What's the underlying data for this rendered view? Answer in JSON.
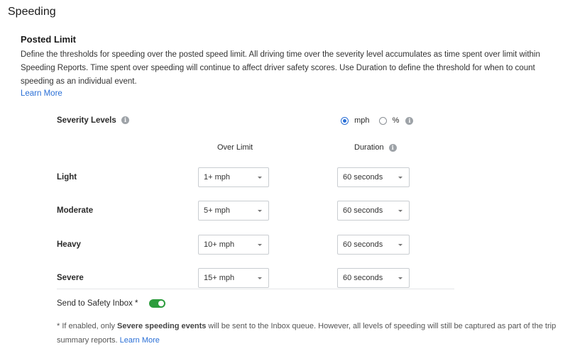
{
  "section": {
    "title": "Speeding",
    "subtitle": "Posted Limit",
    "description": "Define the thresholds for speeding over the posted speed limit. All driving time over the severity level accumulates as time spent over limit within Speeding Reports. Time spent over speeding will continue to affect driver safety scores. Use Duration to define the threshold for when to count speeding as an individual event.",
    "learn_more": "Learn More"
  },
  "severity": {
    "label": "Severity Levels",
    "info_icon": "info-icon",
    "units": [
      {
        "label": "mph",
        "selected": true
      },
      {
        "label": "%",
        "selected": false
      }
    ],
    "column_over_limit": "Over Limit",
    "column_duration": "Duration",
    "rows": [
      {
        "label": "Light",
        "over_limit": "1+ mph",
        "duration": "60 seconds"
      },
      {
        "label": "Moderate",
        "over_limit": "5+ mph",
        "duration": "60 seconds"
      },
      {
        "label": "Heavy",
        "over_limit": "10+ mph",
        "duration": "60 seconds"
      },
      {
        "label": "Severe",
        "over_limit": "15+ mph",
        "duration": "60 seconds"
      }
    ]
  },
  "inbox": {
    "label": "Send to Safety Inbox *",
    "toggle_on": true
  },
  "note": {
    "prefix": "* If enabled, only ",
    "bold": "Severe speeding events",
    "suffix": " will be sent to the Inbox queue. However, all levels of speeding will still be captured as part of the trip summary reports.",
    "learn_more": "Learn More"
  },
  "colors": {
    "link": "#2a6fd6",
    "toggle": "#2c9c3c",
    "radio_selected": "#2a6fd6"
  }
}
